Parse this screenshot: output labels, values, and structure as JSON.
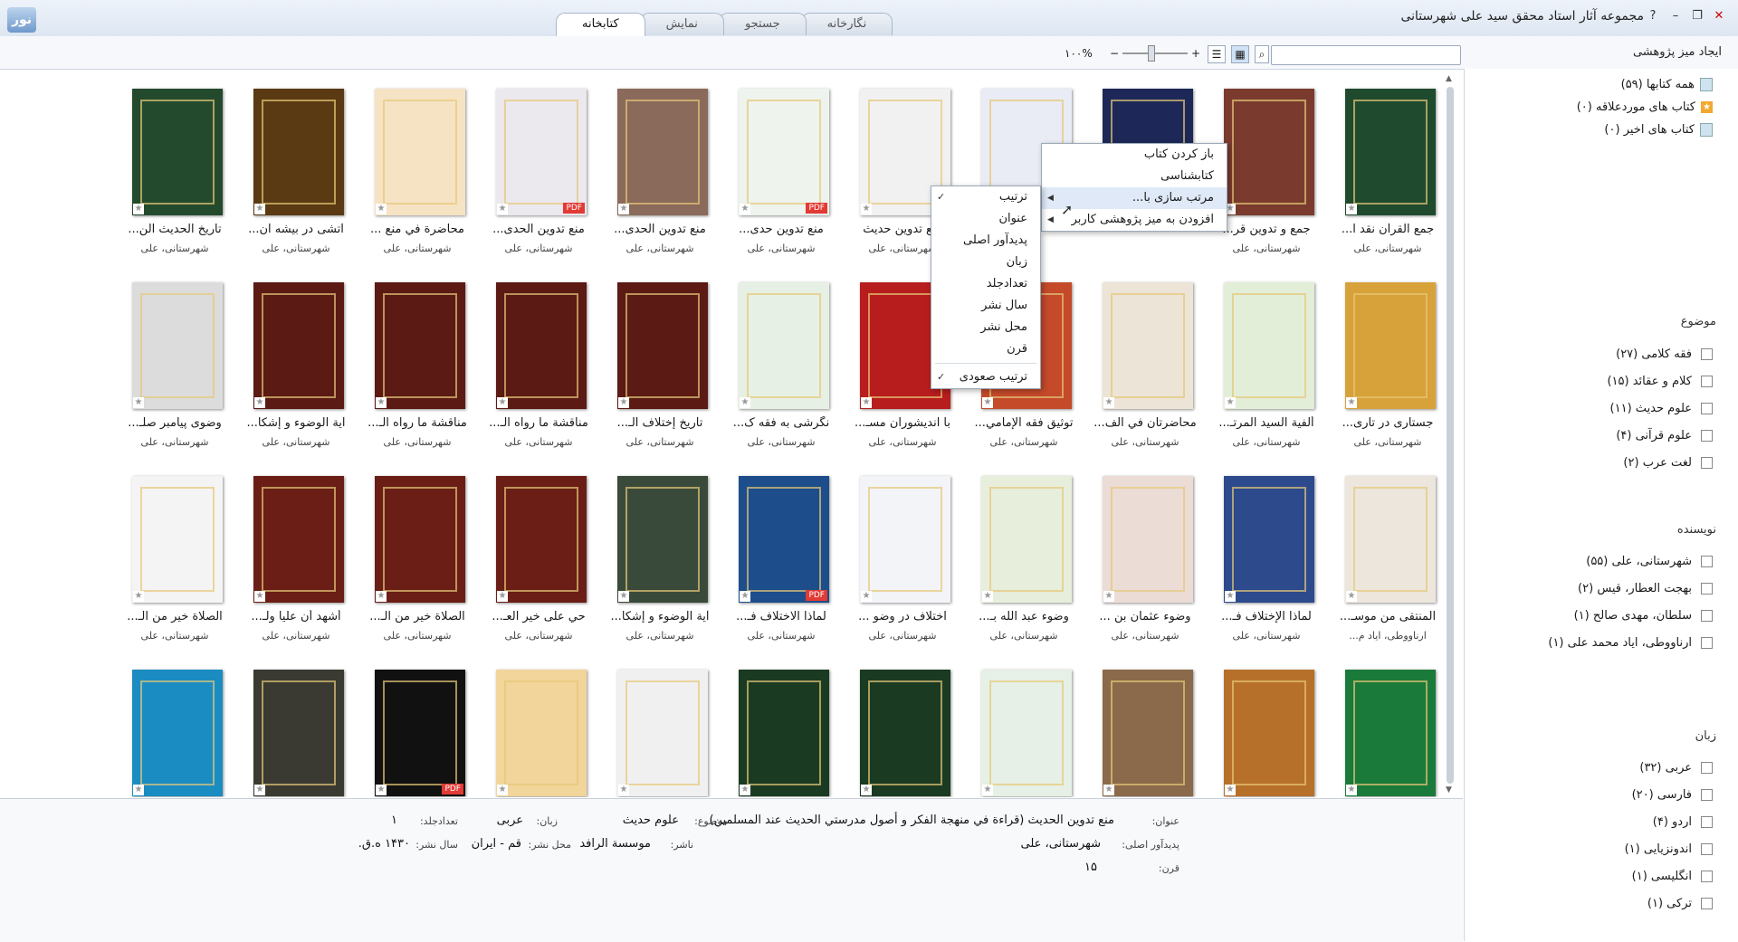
{
  "window": {
    "title": "مجموعه آثار استاد محقق سید علی شهرستانی",
    "app_icon_label": "نور"
  },
  "tabs": [
    "کتابخانه",
    "نمایش",
    "جستجو",
    "نگارخانه"
  ],
  "toolbar": {
    "research_desk": "ایجاد میز پژوهشی",
    "zoom": "۱۰۰%",
    "search_placeholder": ""
  },
  "library": {
    "all_books": "همه کتابها (۵۹)",
    "favorites": "کتاب های موردعلاقه (۰)",
    "recent": "کتاب های اخیر (۰)"
  },
  "facets": {
    "subject": {
      "title": "موضوع",
      "items": [
        "فقه کلامی (۲۷)",
        "کلام و عقائد (۱۵)",
        "علوم حدیث (۱۱)",
        "علوم قرآنی (۴)",
        "لغت عرب (۲)"
      ]
    },
    "author": {
      "title": "نویسنده",
      "items": [
        "شهرستانی، علی (۵۵)",
        "بهجت العطار، قیس (۲)",
        "سلطان، مهدی صالح (۱)",
        "ارناووطی، ایاد محمد علی (۱)"
      ]
    },
    "language": {
      "title": "زبان",
      "items": [
        "عربی (۳۲)",
        "فارسی (۲۰)",
        "اردو (۴)",
        "اندونزیایی (۱)",
        "انگلیسی (۱)",
        "ترکی (۱)"
      ]
    }
  },
  "books": [
    {
      "title": "جمع القرآن نقد ا...",
      "author": "شهرستانی، علی",
      "color": "#1f4a2e",
      "pdf": false
    },
    {
      "title": "جمع و تدوین قر...",
      "author": "شهرستانی، علی",
      "color": "#7a3b2e",
      "pdf": false
    },
    {
      "title": "",
      "author": "",
      "color": "#1d2858",
      "pdf": false
    },
    {
      "title": "",
      "author": "",
      "color": "#e9ecf5",
      "pdf": false
    },
    {
      "title": "منع تدوین حدیث",
      "author": "شهرستانی، علی",
      "color": "#f1f1f1",
      "pdf": false
    },
    {
      "title": "منع تدوین حدی...",
      "author": "شهرستانی، علی",
      "color": "#eef3ee",
      "pdf": true
    },
    {
      "title": "منع تدوین الحدی...",
      "author": "شهرستانی، علی",
      "color": "#8a6a5a",
      "pdf": false
    },
    {
      "title": "منع تدوین الحدی...",
      "author": "شهرستانی، علی",
      "color": "#ebe8ee",
      "pdf": true
    },
    {
      "title": "محاضرة في منع ...",
      "author": "شهرستانی، علی",
      "color": "#f6e3c4",
      "pdf": false
    },
    {
      "title": "آتشی در بیشه ان...",
      "author": "شهرستانی، علی",
      "color": "#5a3a12",
      "pdf": false
    },
    {
      "title": "تاريخ الحديث الن...",
      "author": "شهرستانی، علی",
      "color": "#244a2e",
      "pdf": false
    },
    {
      "title": "جستاری در تاری...",
      "author": "شهرستانی، علی",
      "color": "#d8a23a",
      "pdf": false
    },
    {
      "title": "ألفية السيد المرتـ...",
      "author": "شهرستانی، علی",
      "color": "#e3eed8",
      "pdf": false
    },
    {
      "title": "محاضرتان في الف...",
      "author": "شهرستانی، علی",
      "color": "#ece4d6",
      "pdf": false
    },
    {
      "title": "توثيق فقه الإمامي...",
      "author": "شهرستانی، علی",
      "color": "#c44a2a",
      "pdf": false
    },
    {
      "title": "با اندیشوران مسـ...",
      "author": "شهرستانی، علی",
      "color": "#b81d1d",
      "pdf": false
    },
    {
      "title": "نگرشی به فقه ک...",
      "author": "شهرستانی، علی",
      "color": "#e7f0e4",
      "pdf": false
    },
    {
      "title": "تاريخ إختلاف الـ...",
      "author": "شهرستانی، علی",
      "color": "#5b1a14",
      "pdf": false
    },
    {
      "title": "مناقشة ما رواه الـ...",
      "author": "شهرستانی، علی",
      "color": "#5b1a14",
      "pdf": false
    },
    {
      "title": "مناقشة ما رواه الـ...",
      "author": "شهرستانی، علی",
      "color": "#5b1a14",
      "pdf": false
    },
    {
      "title": "آية الوضوء و إشكا...",
      "author": "شهرستانی، علی",
      "color": "#5b1a14",
      "pdf": false
    },
    {
      "title": "وضوی پيامبر صلـ...",
      "author": "شهرستانی، علی",
      "color": "#dcdcdc",
      "pdf": false
    },
    {
      "title": "المنتقى من موسـ...",
      "author": "ارناووطی، ایاد م...",
      "color": "#ece6dc",
      "pdf": false
    },
    {
      "title": "لماذا الإختلاف فـ...",
      "author": "شهرستانی، علی",
      "color": "#2c4a8c",
      "pdf": false
    },
    {
      "title": "وضوء عثمان بن ...",
      "author": "شهرستانی، علی",
      "color": "#ecdcd6",
      "pdf": false
    },
    {
      "title": "وضوء عبد الله بـ...",
      "author": "شهرستانی، علی",
      "color": "#e8eedc",
      "pdf": false
    },
    {
      "title": "اختلاف در وضو ...",
      "author": "شهرستانی، علی",
      "color": "#f2f4f8",
      "pdf": false
    },
    {
      "title": "لماذا الاختلاف فـ...",
      "author": "شهرستانی، علی",
      "color": "#1d4d8a",
      "pdf": true
    },
    {
      "title": "آية الوضوء و إشكا...",
      "author": "شهرستانی، علی",
      "color": "#3a4a3a",
      "pdf": false
    },
    {
      "title": "حي على خير العـ...",
      "author": "شهرستانی، علی",
      "color": "#6a1e16",
      "pdf": false
    },
    {
      "title": "الصلاة خير من الـ...",
      "author": "شهرستانی، علی",
      "color": "#6a1e16",
      "pdf": false
    },
    {
      "title": "أشهد أن عليا ولـ...",
      "author": "شهرستانی، علی",
      "color": "#6a1e16",
      "pdf": false
    },
    {
      "title": "الصلاة خير من الـ...",
      "author": "شهرستانی، علی",
      "color": "#f4f4f4",
      "pdf": false
    },
    {
      "title": "",
      "author": "",
      "color": "#1a7a3a",
      "pdf": false
    },
    {
      "title": "",
      "author": "",
      "color": "#b7702a",
      "pdf": false
    },
    {
      "title": "",
      "author": "",
      "color": "#8a6a4a",
      "pdf": false
    },
    {
      "title": "",
      "author": "",
      "color": "#e6f0e6",
      "pdf": false
    },
    {
      "title": "",
      "author": "",
      "color": "#1a3a22",
      "pdf": false
    },
    {
      "title": "",
      "author": "",
      "color": "#1a3a22",
      "pdf": false
    },
    {
      "title": "",
      "author": "",
      "color": "#f0f0f0",
      "pdf": false
    },
    {
      "title": "",
      "author": "",
      "color": "#f2d59a",
      "pdf": false
    },
    {
      "title": "",
      "author": "",
      "color": "#111111",
      "pdf": true
    },
    {
      "title": "",
      "author": "",
      "color": "#3a3a32",
      "pdf": false
    },
    {
      "title": "",
      "author": "",
      "color": "#1a8cc2",
      "pdf": false
    }
  ],
  "context_menu": {
    "items": [
      "باز کردن کتاب",
      "کتابشناسی",
      "مرتب سازی با...",
      "افزودن به میز پژوهشی کاربر"
    ]
  },
  "sort_menu": {
    "items": [
      "ترتیب",
      "عنوان",
      "پدیدآور اصلی",
      "زبان",
      "تعدادجلد",
      "سال نشر",
      "محل نشر",
      "قرن"
    ],
    "ascending": "ترتیب صعودی"
  },
  "details": {
    "title_label": "عنوان:",
    "title_value": "منع تدوين الحديث (قراءة في منهجة الفكر و أصول مدرستي الحديث عند المسلمين)",
    "subject_label": "موضوع:",
    "subject_value": "علوم حدیث",
    "lang_label": "زبان:",
    "lang_value": "عربی",
    "volumes_label": "تعدادجلد:",
    "volumes_value": "۱",
    "author_label": "پدیدآور اصلی:",
    "author_value": "شهرستانی، علی",
    "publisher_label": "ناشر:",
    "publisher_value": "موسسة الرافد",
    "place_label": "محل نشر:",
    "place_value": "قم - ایران",
    "year_label": "سال نشر:",
    "year_value": "۱۴۳۰ ه.ق.",
    "century_label": "قرن:",
    "century_value": "۱۵"
  }
}
